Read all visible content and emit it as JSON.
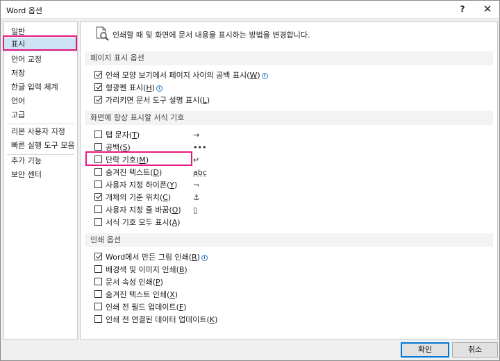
{
  "window": {
    "title": "Word 옵션",
    "help_label": "?",
    "close_label": "✕"
  },
  "nav": {
    "items": [
      {
        "label": "일반"
      },
      {
        "label": "표시"
      },
      {
        "label": "언어 교정"
      },
      {
        "label": "저장"
      },
      {
        "label": "한글 입력 체계"
      },
      {
        "label": "언어"
      },
      {
        "label": "고급"
      },
      {
        "label": "리본 사용자 지정"
      },
      {
        "label": "빠른 실행 도구 모음"
      },
      {
        "label": "추가 기능"
      },
      {
        "label": "보안 센터"
      }
    ]
  },
  "header": {
    "text": "인쇄할 때 및 화면에 문서 내용을 표시하는 방법을 변경합니다.",
    "icon": "document-magnifier-icon"
  },
  "sections": {
    "page_display": {
      "title": "페이지 표시 옵션",
      "options": [
        {
          "label": "인쇄 모양 보기에서 페이지 사이의 공백 표시(",
          "key": "W",
          "suffix": ")",
          "checked": true,
          "info": true
        },
        {
          "label": "형광펜 표시(",
          "key": "H",
          "suffix": ")",
          "checked": true,
          "info": true
        },
        {
          "label": "가리키면 문서 도구 설명 표시(",
          "key": "L",
          "suffix": ")",
          "checked": true,
          "info": false
        }
      ]
    },
    "format_marks": {
      "title": "화면에 항상 표시할 서식 기호",
      "options": [
        {
          "label": "탭 문자(",
          "key": "T",
          "suffix": ")",
          "checked": false,
          "symbol": "→"
        },
        {
          "label": "공백(",
          "key": "S",
          "suffix": ")",
          "checked": false,
          "symbol": "•••"
        },
        {
          "label": "단락 기호(",
          "key": "M",
          "suffix": ")",
          "checked": false,
          "symbol": "↵"
        },
        {
          "label": "숨겨진 텍스트(",
          "key": "D",
          "suffix": ")",
          "checked": false,
          "symbol": "abc"
        },
        {
          "label": "사용자 지정 하이픈(",
          "key": "Y",
          "suffix": ")",
          "checked": false,
          "symbol": "¬"
        },
        {
          "label": "개체의 기준 위치(",
          "key": "C",
          "suffix": ")",
          "checked": true,
          "symbol": "⚓"
        },
        {
          "label": "사용자 지정 줄 바꿈(",
          "key": "O",
          "suffix": ")",
          "checked": false,
          "symbol": "▯"
        },
        {
          "label": "서식 기호 모두 표시(",
          "key": "A",
          "suffix": ")",
          "checked": false,
          "symbol": ""
        }
      ]
    },
    "print": {
      "title": "인쇄 옵션",
      "options": [
        {
          "label": "Word에서 만든 그림 인쇄(",
          "key": "R",
          "suffix": ")",
          "checked": true,
          "info": true
        },
        {
          "label": "배경색 및 이미지 인쇄(",
          "key": "B",
          "suffix": ")",
          "checked": false,
          "info": false
        },
        {
          "label": "문서 속성 인쇄(",
          "key": "P",
          "suffix": ")",
          "checked": false,
          "info": false
        },
        {
          "label": "숨겨진 텍스트 인쇄(",
          "key": "X",
          "suffix": ")",
          "checked": false,
          "info": false
        },
        {
          "label": "인쇄 전 필드 업데이트(",
          "key": "F",
          "suffix": ")",
          "checked": false,
          "info": false
        },
        {
          "label": "인쇄 전 연결된 데이터 업데이트(",
          "key": "K",
          "suffix": ")",
          "checked": false,
          "info": false
        }
      ]
    }
  },
  "footer": {
    "ok_label": "확인",
    "cancel_label": "취소"
  },
  "colors": {
    "highlight": "#e8177d",
    "selected_nav": "#cde4f7",
    "accent": "#0078d7"
  }
}
